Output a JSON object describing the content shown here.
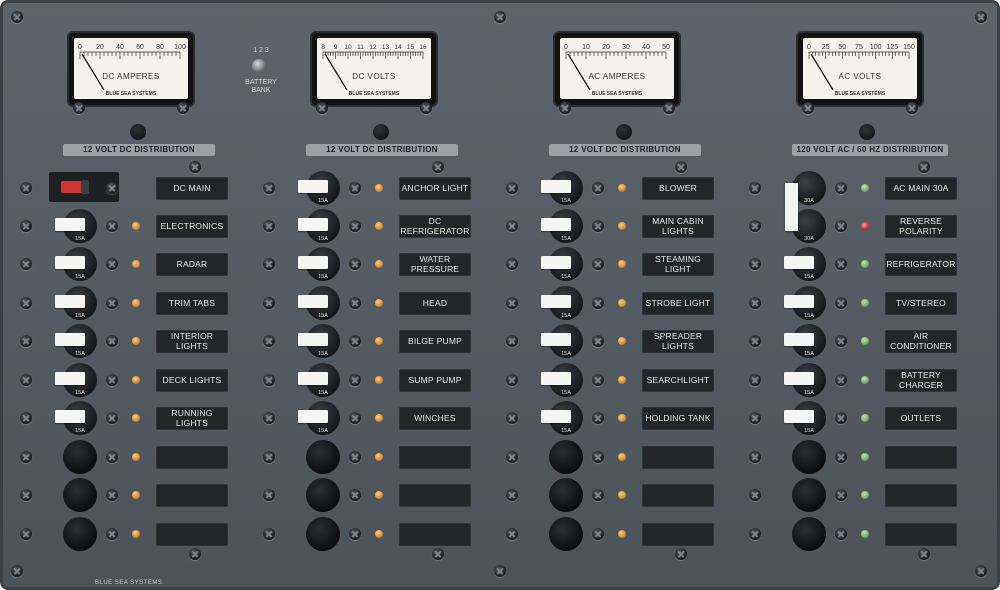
{
  "meters": [
    {
      "name": "dc-amperes-meter",
      "label": "DC AMPERES",
      "ticks": [
        "0",
        "20",
        "40",
        "60",
        "80",
        "100"
      ],
      "brand": "BLUE SEA SYSTEMS"
    },
    {
      "name": "dc-volts-meter",
      "label": "DC VOLTS",
      "ticks": [
        "8",
        "9",
        "10",
        "11",
        "12",
        "13",
        "14",
        "15",
        "16"
      ],
      "brand": "BLUE SEA SYSTEMS"
    },
    {
      "name": "ac-amperes-meter",
      "label": "AC AMPERES",
      "ticks": [
        "0",
        "10",
        "20",
        "30",
        "40",
        "50"
      ],
      "brand": "BLUE SEA SYSTEMS"
    },
    {
      "name": "ac-volts-meter",
      "label": "AC VOLTS",
      "ticks": [
        "0",
        "25",
        "50",
        "75",
        "100",
        "125",
        "150"
      ],
      "brand": "BLUE SEA SYSTEMS"
    }
  ],
  "battery_bank": {
    "label_line1": "BATTERY",
    "label_line2": "BANK",
    "positions": [
      "1",
      "2",
      "3"
    ]
  },
  "columns": [
    {
      "header": "12 VOLT DC DISTRIBUTION",
      "led_color": "amber",
      "rows": [
        {
          "label": "DC MAIN",
          "breaker": "main"
        },
        {
          "label": "ELECTRONICS",
          "breaker": "15A"
        },
        {
          "label": "RADAR",
          "breaker": "15A"
        },
        {
          "label": "TRIM TABS",
          "breaker": "15A"
        },
        {
          "label": "INTERIOR LIGHTS",
          "breaker": "15A"
        },
        {
          "label": "DECK LIGHTS",
          "breaker": "15A"
        },
        {
          "label": "RUNNING LIGHTS",
          "breaker": "15A"
        },
        {
          "label": "",
          "breaker": "blank"
        },
        {
          "label": "",
          "breaker": "blank"
        },
        {
          "label": "",
          "breaker": "blank"
        }
      ]
    },
    {
      "header": "12 VOLT DC DISTRIBUTION",
      "led_color": "amber",
      "rows": [
        {
          "label": "ANCHOR LIGHT",
          "breaker": "15A"
        },
        {
          "label": "DC REFRIGERATOR",
          "breaker": "15A"
        },
        {
          "label": "WATER PRESSURE",
          "breaker": "15A"
        },
        {
          "label": "HEAD",
          "breaker": "15A"
        },
        {
          "label": "BILGE PUMP",
          "breaker": "15A"
        },
        {
          "label": "SUMP PUMP",
          "breaker": "15A"
        },
        {
          "label": "WINCHES",
          "breaker": "15A"
        },
        {
          "label": "",
          "breaker": "blank"
        },
        {
          "label": "",
          "breaker": "blank"
        },
        {
          "label": "",
          "breaker": "blank"
        }
      ]
    },
    {
      "header": "12 VOLT DC DISTRIBUTION",
      "led_color": "amber",
      "rows": [
        {
          "label": "BLOWER",
          "breaker": "15A"
        },
        {
          "label": "MAIN CABIN LIGHTS",
          "breaker": "15A"
        },
        {
          "label": "STEAMING LIGHT",
          "breaker": "15A"
        },
        {
          "label": "STROBE LIGHT",
          "breaker": "15A"
        },
        {
          "label": "SPREADER LIGHTS",
          "breaker": "15A"
        },
        {
          "label": "SEARCHLIGHT",
          "breaker": "15A"
        },
        {
          "label": "HOLDING TANK",
          "breaker": "15A"
        },
        {
          "label": "",
          "breaker": "blank"
        },
        {
          "label": "",
          "breaker": "blank"
        },
        {
          "label": "",
          "breaker": "blank"
        }
      ]
    },
    {
      "header": "120 VOLT AC / 60 HZ DISTRIBUTION",
      "led_color": "green",
      "rows": [
        {
          "label": "AC MAIN 30A",
          "breaker": "30A",
          "main": true
        },
        {
          "label": "REVERSE POLARITY",
          "breaker": "30A",
          "main": true,
          "led": "red"
        },
        {
          "label": "REFRIGERATOR",
          "breaker": "15A"
        },
        {
          "label": "TV/STEREO",
          "breaker": "15A"
        },
        {
          "label": "AIR CONDITIONER",
          "breaker": "15A"
        },
        {
          "label": "BATTERY CHARGER",
          "breaker": "15A"
        },
        {
          "label": "OUTLETS",
          "breaker": "15A"
        },
        {
          "label": "",
          "breaker": "blank"
        },
        {
          "label": "",
          "breaker": "blank"
        },
        {
          "label": "",
          "breaker": "blank"
        }
      ]
    }
  ],
  "footer": {
    "brand": "BLUE SEA SYSTEMS"
  }
}
